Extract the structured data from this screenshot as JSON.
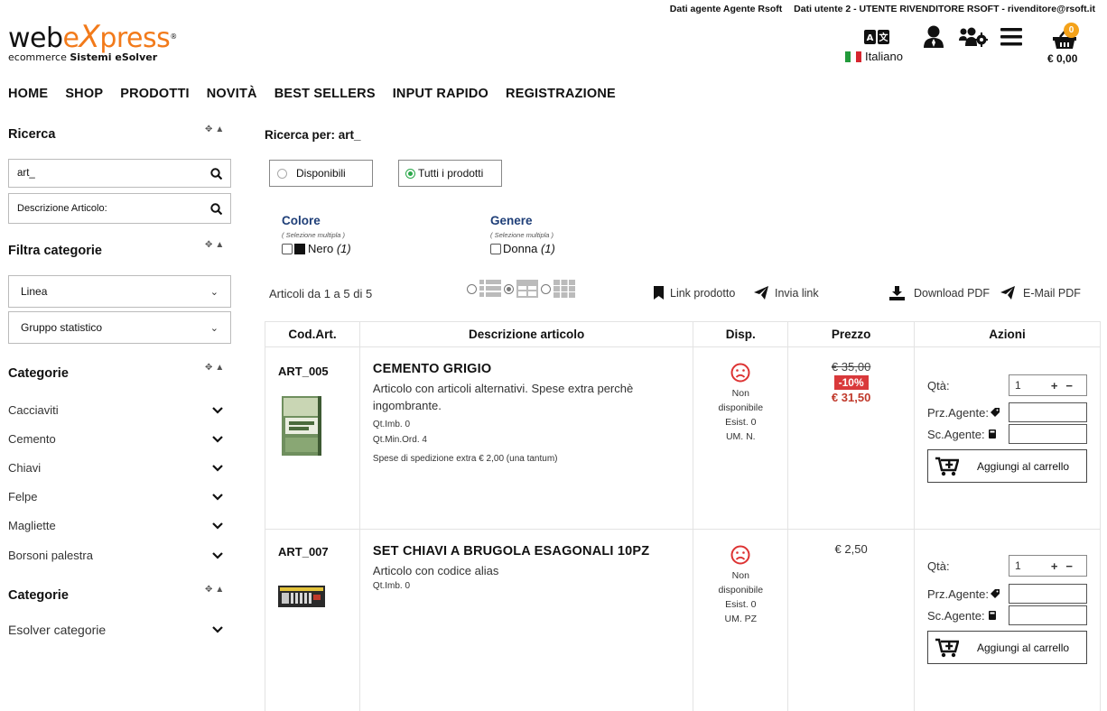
{
  "topbar": {
    "agent": "Dati agente Agente Rsoft",
    "user": "Dati utente 2 - UTENTE RIVENDITORE RSOFT - rivenditore@rsoft.it"
  },
  "logo": {
    "web": "web",
    "express_e": "e",
    "express_x": "X",
    "express_rest": "press",
    "reg": "®",
    "tag_light": "ecommerce",
    "tag_bold": "Sistemi eSolver"
  },
  "header": {
    "language": "Italiano",
    "cart_count": "0",
    "cart_total": "€ 0,00"
  },
  "nav": [
    "HOME",
    "SHOP",
    "PRODOTTI",
    "NOVITÀ",
    "BEST SELLERS",
    "INPUT RAPIDO",
    "REGISTRAZIONE"
  ],
  "sidebar": {
    "search_title": "Ricerca",
    "search_value": "art_",
    "search_field2": "Descrizione Articolo:",
    "filter_title": "Filtra categorie",
    "select1": "Linea",
    "select2": "Gruppo statistico",
    "categories_title": "Categorie",
    "categories": [
      "Cacciaviti",
      "Cemento",
      "Chiavi",
      "Felpe",
      "Magliette",
      "Borsoni palestra"
    ],
    "categories2_title": "Categorie",
    "categories2": [
      "Esolver categorie"
    ]
  },
  "main": {
    "search_for": "Ricerca per: art_",
    "radio_available": "Disponibili",
    "radio_all": "Tutti i prodotti",
    "filter_color_title": "Colore",
    "filter_color_hint": "( Selezione multipla )",
    "filter_color_opt": "Nero",
    "filter_color_count": "(1)",
    "filter_genre_title": "Genere",
    "filter_genre_hint": "( Selezione multipla )",
    "filter_genre_opt": "Donna",
    "filter_genre_count": "(1)",
    "count_text": "Articoli da 1 a 5 di 5",
    "link_product": "Link prodotto",
    "send_link": "Invia link",
    "download_pdf": "Download PDF",
    "email_pdf": "E-Mail PDF"
  },
  "table": {
    "headers": [
      "Cod.Art.",
      "Descrizione articolo",
      "Disp.",
      "Prezzo",
      "Azioni"
    ],
    "labels": {
      "qty": "Qtà:",
      "agent_price": "Prz.Agente:",
      "agent_discount": "Sc.Agente:",
      "add_cart": "Aggiungi al carrello"
    },
    "rows": [
      {
        "code": "ART_005",
        "name": "CEMENTO GRIGIO",
        "sub": "Articolo con articoli alternativi. Spese extra perchè ingombrante.",
        "line1": "Qt.Imb. 0",
        "line2": "Qt.Min.Ord. 4",
        "line3": "Spese di spedizione extra € 2,00 (una tantum)",
        "disp1": "Non",
        "disp2": "disponibile",
        "disp3": "Esist. 0",
        "disp4": "UM. N.",
        "price_old": "€ 35,00",
        "discount": "-10%",
        "price_new": "€ 31,50",
        "qty": "1"
      },
      {
        "code": "ART_007",
        "name": "SET CHIAVI A BRUGOLA ESAGONALI 10PZ",
        "sub": "Articolo con codice alias",
        "line1": "Qt.Imb. 0",
        "disp1": "Non",
        "disp2": "disponibile",
        "disp3": "Esist. 0",
        "disp4": "UM. PZ",
        "price": "€ 2,50",
        "qty": "1"
      }
    ]
  },
  "colors": {
    "accent_orange": "#f27a1a",
    "filter_blue": "#1f3f78",
    "discount_red": "#d9393b",
    "radio_green": "#2aa84a"
  }
}
